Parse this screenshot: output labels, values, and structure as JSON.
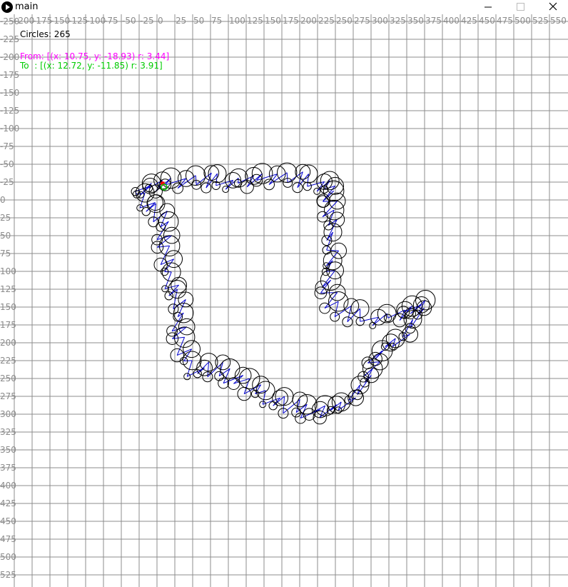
{
  "window": {
    "title": "main",
    "minimize_icon": "minimize-icon",
    "maximize_icon": "maximize-icon",
    "close_icon": "close-icon"
  },
  "hud": {
    "circles_label": "Circles: 265",
    "from_label": "From: [(x: 10.75, y: -18.93) r: 3.44]",
    "to_label": "To  : [(x: 12.72, y: -11.85) r: 3.91]"
  },
  "axes": {
    "x_ticks": [
      -200,
      -175,
      -150,
      -125,
      -100,
      -75,
      -50,
      -25,
      0,
      25,
      50,
      75,
      100,
      125,
      150,
      175,
      200,
      225,
      250,
      275,
      300,
      325,
      350,
      375,
      400,
      425,
      450,
      475,
      500,
      525,
      550
    ],
    "y_ticks": [
      -250,
      -225,
      -200,
      -175,
      -150,
      -125,
      -100,
      -75,
      -50,
      -25,
      0,
      25,
      50,
      75,
      100,
      125,
      150,
      175,
      200,
      225,
      250,
      275,
      300,
      325,
      350,
      375,
      400,
      425,
      450,
      475,
      500,
      525
    ]
  },
  "colors": {
    "grid": "#8c8c8c",
    "label": "#8c8c8c",
    "circle_stroke": "#000000",
    "link": "#0000cc",
    "from": "#ff00ff",
    "to": "#00cc00",
    "marker": "#ff0000"
  }
}
